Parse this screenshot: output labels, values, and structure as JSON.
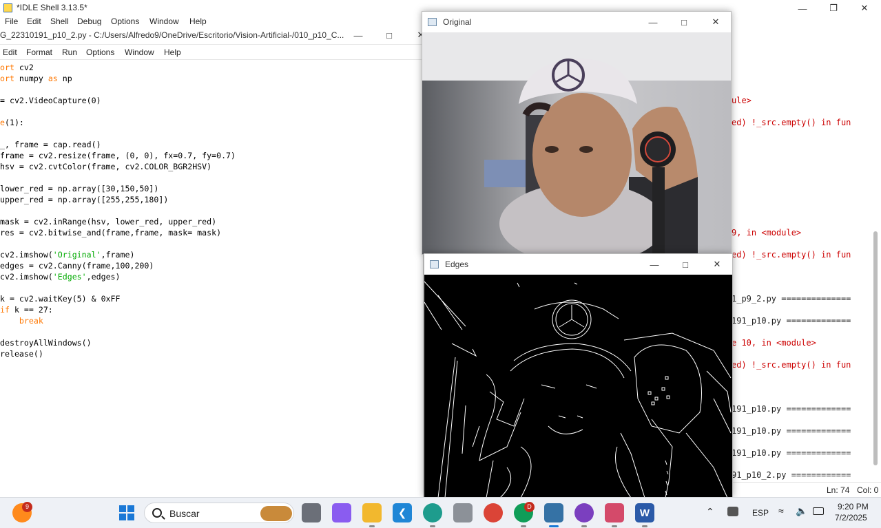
{
  "shell": {
    "title": "*IDLE Shell 3.13.5*",
    "menu": [
      "File",
      "Edit",
      "Shell",
      "Debug",
      "Options",
      "Window",
      "Help"
    ],
    "output_lines": [
      {
        "text": "ule>",
        "color": "red"
      },
      {
        "text": "ed) !_src.empty() in fun",
        "color": "red"
      },
      {
        "text": "9, in <module>",
        "color": "red"
      },
      {
        "text": "ed) !_src.empty() in fun",
        "color": "red"
      },
      {
        "text": "1_p9_2.py ==============",
        "color": "plain"
      },
      {
        "text": "191_p10.py =============",
        "color": "plain"
      },
      {
        "text": "e 10, in <module>",
        "color": "red"
      },
      {
        "text": "ed) !_src.empty() in fun",
        "color": "red"
      },
      {
        "text": "191_p10.py =============",
        "color": "plain"
      },
      {
        "text": "191_p10.py =============",
        "color": "plain"
      },
      {
        "text": "191_p10.py =============",
        "color": "plain"
      },
      {
        "text": "91_p10_2.py ============",
        "color": "plain"
      }
    ],
    "status_ln": "Ln: 74",
    "status_col": "Col: 0"
  },
  "editor": {
    "title": "G_22310191_p10_2.py - C:/Users/Alfredo9/OneDrive/Escritorio/Vision-Artificial-/010_p10_C...",
    "menu": [
      "Edit",
      "Format",
      "Run",
      "Options",
      "Window",
      "Help"
    ],
    "code": [
      [
        {
          "t": "ort",
          "c": "kw"
        },
        {
          "t": " cv2"
        }
      ],
      [
        {
          "t": "ort",
          "c": "kw"
        },
        {
          "t": " numpy "
        },
        {
          "t": "as",
          "c": "kw"
        },
        {
          "t": " np"
        }
      ],
      [],
      [
        {
          "t": "= cv2.VideoCapture(0)"
        }
      ],
      [],
      [
        {
          "t": "e",
          "c": "kw"
        },
        {
          "t": "(1):"
        }
      ],
      [],
      [
        {
          "t": "_, frame = cap.read()"
        }
      ],
      [
        {
          "t": "frame = cv2.resize(frame, (0, 0), fx=0.7, fy=0.7)"
        }
      ],
      [
        {
          "t": "hsv = cv2.cvtColor(frame, cv2.COLOR_BGR2HSV)"
        }
      ],
      [],
      [
        {
          "t": "lower_red = np.array([30,150,50])"
        }
      ],
      [
        {
          "t": "upper_red = np.array([255,255,180])"
        }
      ],
      [],
      [
        {
          "t": "mask = cv2.inRange(hsv, lower_red, upper_red)"
        }
      ],
      [
        {
          "t": "res = cv2.bitwise_and(frame,frame, mask= mask)"
        }
      ],
      [],
      [
        {
          "t": "cv2.imshow("
        },
        {
          "t": "'Original'",
          "c": "str"
        },
        {
          "t": ",frame)"
        }
      ],
      [
        {
          "t": "edges = cv2.Canny(frame,100,200)"
        }
      ],
      [
        {
          "t": "cv2.imshow("
        },
        {
          "t": "'Edges'",
          "c": "str"
        },
        {
          "t": ",edges)"
        }
      ],
      [],
      [
        {
          "t": "k = cv2.waitKey(5) & 0xFF"
        }
      ],
      [
        {
          "t": "if",
          "c": "kw"
        },
        {
          "t": " k == 27:"
        }
      ],
      [
        {
          "t": "    "
        },
        {
          "t": "break",
          "c": "kw"
        }
      ],
      [],
      [
        {
          "t": "destroyAllWindows()"
        }
      ],
      [
        {
          "t": "release()"
        }
      ]
    ]
  },
  "original_window": {
    "title": "Original"
  },
  "edges_window": {
    "title": "Edges"
  },
  "taskbar": {
    "search_placeholder": "Buscar",
    "firefox_badge": "9",
    "chrome_badge": "D",
    "language": "ESP",
    "time": "9:20 PM",
    "date": "7/2/2025"
  }
}
